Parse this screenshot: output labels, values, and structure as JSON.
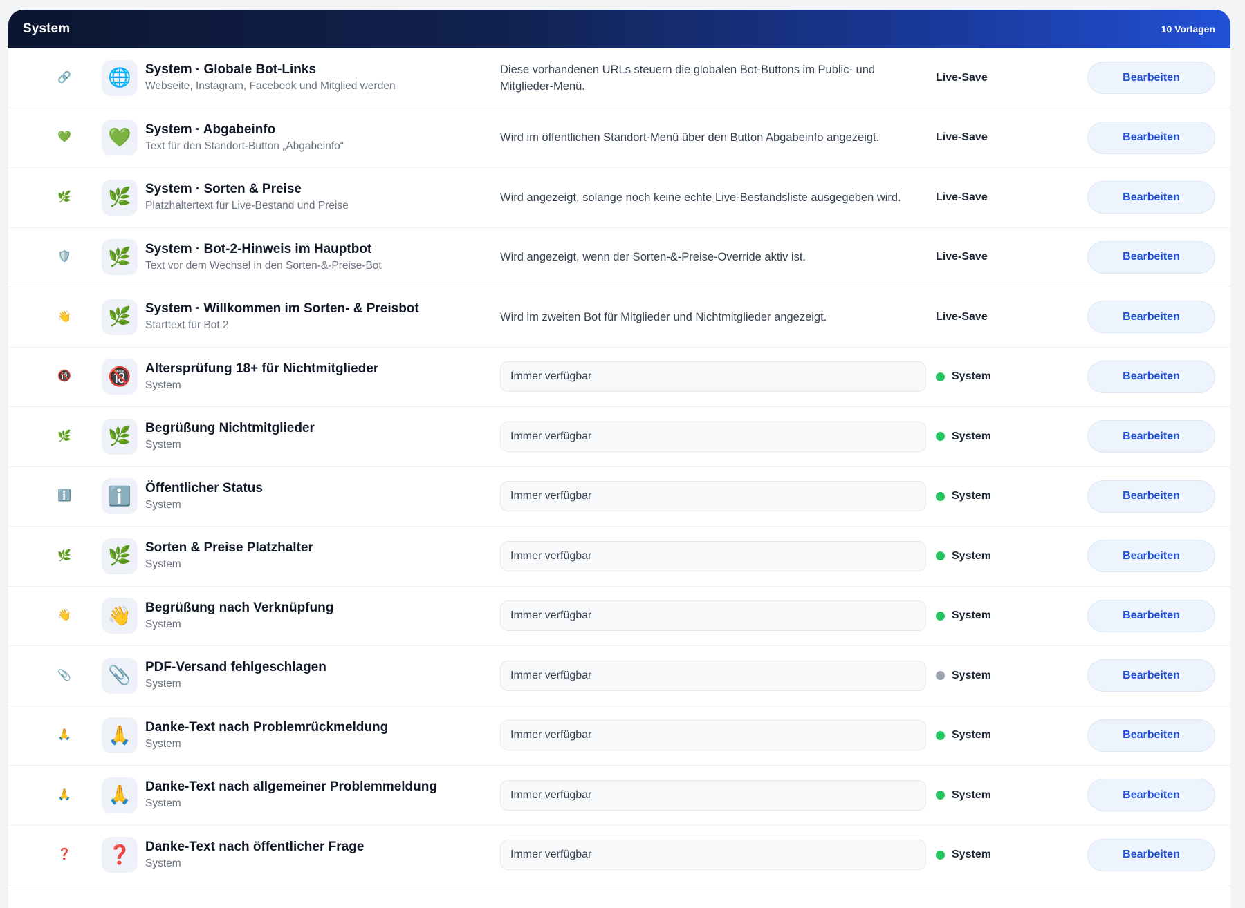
{
  "section": {
    "title": "System",
    "count_label": "10 Vorlagen"
  },
  "colors": {
    "header_start": "#0b1530",
    "header_end": "#2251d6",
    "accent": "#1d4ed8",
    "status_green": "#22c55e",
    "status_gray": "#9ca3af"
  },
  "rows": [
    {
      "icon": "🔗",
      "icon_name": "link-icon",
      "tile": "🌐",
      "tile_name": "globe-icon",
      "title": "System · Globale Bot-Links",
      "subtitle": "Webseite, Instagram, Facebook und Mitglied werden",
      "desc_type": "text",
      "description": "Diese vorhandenen URLs steuern die globalen Bot-Buttons im Public- und Mitglieder-Menü.",
      "status_type": "live",
      "status": "Live-Save",
      "button": "Bearbeiten"
    },
    {
      "icon": "💚",
      "icon_name": "green-heart-icon",
      "tile": "💚",
      "tile_name": "green-heart-icon",
      "title": "System · Abgabeinfo",
      "subtitle": "Text für den Standort-Button „Abgabeinfo“",
      "desc_type": "text",
      "description": "Wird im öffentlichen Standort-Menü über den Button Abgabeinfo angezeigt.",
      "status_type": "live",
      "status": "Live-Save",
      "button": "Bearbeiten"
    },
    {
      "icon": "🌿",
      "icon_name": "herb-icon",
      "tile": "🌿",
      "tile_name": "herb-icon",
      "title": "System · Sorten & Preise",
      "subtitle": "Platzhaltertext für Live-Bestand und Preise",
      "desc_type": "text",
      "description": "Wird angezeigt, solange noch keine echte Live-Bestandsliste ausgegeben wird.",
      "status_type": "live",
      "status": "Live-Save",
      "button": "Bearbeiten"
    },
    {
      "icon": "🛡️",
      "icon_name": "shield-icon",
      "tile": "🌿",
      "tile_name": "herb-icon",
      "title": "System · Bot-2-Hinweis im Hauptbot",
      "subtitle": "Text vor dem Wechsel in den Sorten-&-Preise-Bot",
      "desc_type": "text",
      "description": "Wird angezeigt, wenn der Sorten-&-Preise-Override aktiv ist.",
      "status_type": "live",
      "status": "Live-Save",
      "button": "Bearbeiten"
    },
    {
      "icon": "👋",
      "icon_name": "waving-hand-icon",
      "tile": "🌿",
      "tile_name": "herb-icon",
      "title": "System · Willkommen im Sorten- & Preisbot",
      "subtitle": "Starttext für Bot 2",
      "desc_type": "text",
      "description": "Wird im zweiten Bot für Mitglieder und Nichtmitglieder angezeigt.",
      "status_type": "live",
      "status": "Live-Save",
      "button": "Bearbeiten"
    },
    {
      "icon": "🔞",
      "icon_name": "no-under-18-icon",
      "tile": "🔞",
      "tile_name": "no-under-18-icon",
      "title": "Altersprüfung 18+ für Nichtmitglieder",
      "subtitle": "System",
      "desc_type": "pill",
      "description": "Immer verfügbar",
      "status_type": "system",
      "status_color": "green",
      "status": "System",
      "button": "Bearbeiten"
    },
    {
      "icon": "🌿",
      "icon_name": "herb-icon",
      "tile": "🌿",
      "tile_name": "herb-icon",
      "title": "Begrüßung Nichtmitglieder",
      "subtitle": "System",
      "desc_type": "pill",
      "description": "Immer verfügbar",
      "status_type": "system",
      "status_color": "green",
      "status": "System",
      "button": "Bearbeiten"
    },
    {
      "icon": "ℹ️",
      "icon_name": "info-icon",
      "tile": "ℹ️",
      "tile_name": "info-icon",
      "title": "Öffentlicher Status",
      "subtitle": "System",
      "desc_type": "pill",
      "description": "Immer verfügbar",
      "status_type": "system",
      "status_color": "green",
      "status": "System",
      "button": "Bearbeiten"
    },
    {
      "icon": "🌿",
      "icon_name": "herb-icon",
      "tile": "🌿",
      "tile_name": "herb-icon",
      "title": "Sorten & Preise Platzhalter",
      "subtitle": "System",
      "desc_type": "pill",
      "description": "Immer verfügbar",
      "status_type": "system",
      "status_color": "green",
      "status": "System",
      "button": "Bearbeiten"
    },
    {
      "icon": "👋",
      "icon_name": "waving-hand-icon",
      "tile": "👋",
      "tile_name": "waving-hand-icon",
      "title": "Begrüßung nach Verknüpfung",
      "subtitle": "System",
      "desc_type": "pill",
      "description": "Immer verfügbar",
      "status_type": "system",
      "status_color": "green",
      "status": "System",
      "button": "Bearbeiten"
    },
    {
      "icon": "📎",
      "icon_name": "paperclip-icon",
      "tile": "📎",
      "tile_name": "paperclip-icon",
      "title": "PDF-Versand fehlgeschlagen",
      "subtitle": "System",
      "desc_type": "pill",
      "description": "Immer verfügbar",
      "status_type": "system",
      "status_color": "gray",
      "status": "System",
      "button": "Bearbeiten"
    },
    {
      "icon": "🙏",
      "icon_name": "folded-hands-icon",
      "tile": "🙏",
      "tile_name": "folded-hands-icon",
      "title": "Danke-Text nach Problemrückmeldung",
      "subtitle": "System",
      "desc_type": "pill",
      "description": "Immer verfügbar",
      "status_type": "system",
      "status_color": "green",
      "status": "System",
      "button": "Bearbeiten"
    },
    {
      "icon": "🙏",
      "icon_name": "folded-hands-icon",
      "tile": "🙏",
      "tile_name": "folded-hands-icon",
      "title": "Danke-Text nach allgemeiner Problemmeldung",
      "subtitle": "System",
      "desc_type": "pill",
      "description": "Immer verfügbar",
      "status_type": "system",
      "status_color": "green",
      "status": "System",
      "button": "Bearbeiten"
    },
    {
      "icon": "❓",
      "icon_name": "question-mark-icon",
      "tile": "❓",
      "tile_name": "question-mark-icon",
      "title": "Danke-Text nach öffentlicher Frage",
      "subtitle": "System",
      "desc_type": "pill",
      "description": "Immer verfügbar",
      "status_type": "system",
      "status_color": "green",
      "status": "System",
      "button": "Bearbeiten"
    }
  ]
}
